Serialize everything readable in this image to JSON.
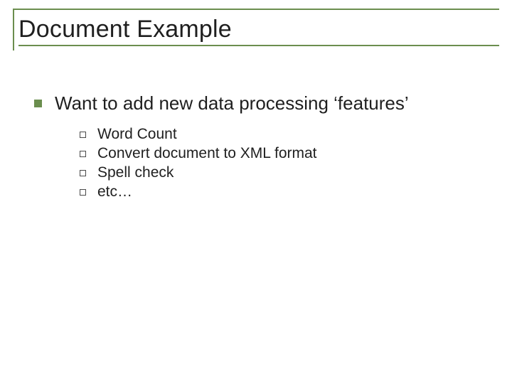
{
  "slide": {
    "title": "Document Example",
    "bullet": {
      "text": "Want to add new data processing ‘features’",
      "subitems": [
        "Word Count",
        "Convert document to XML format",
        "Spell check",
        "etc…"
      ]
    }
  },
  "colors": {
    "accent": "#6b8e4e",
    "text": "#1f1f1f"
  }
}
